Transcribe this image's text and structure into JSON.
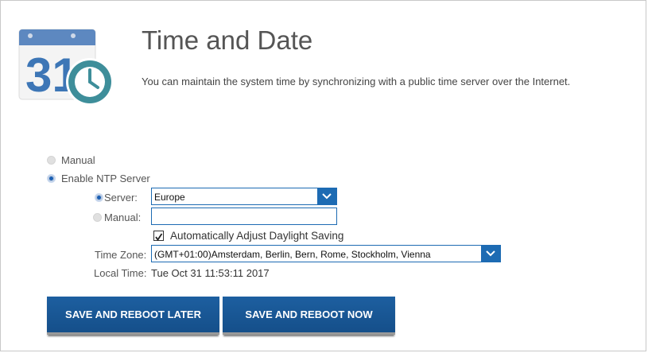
{
  "header": {
    "title": "Time and Date",
    "description": "You can maintain the system time by synchronizing with a public time server over the Internet.",
    "icon": "calendar-clock-icon",
    "icon_day": "31"
  },
  "mode": {
    "manual_label": "Manual",
    "ntp_label": "Enable NTP Server",
    "selected": "ntp"
  },
  "ntp": {
    "server_label": "Server:",
    "server_value": "Europe",
    "manual_label": "Manual:",
    "manual_value": "",
    "server_mode": "server",
    "dst_label": "Automatically Adjust Daylight Saving",
    "dst_checked": true
  },
  "timezone": {
    "label": "Time Zone:",
    "value": "(GMT+01:00)Amsterdam, Berlin, Bern, Rome, Stockholm, Vienna"
  },
  "local_time": {
    "label": "Local Time:",
    "value": "Tue Oct 31 11:53:11 2017"
  },
  "actions": {
    "save_later": "SAVE AND REBOOT LATER",
    "save_now": "SAVE AND REBOOT NOW"
  },
  "colors": {
    "accent": "#1d6bb3",
    "button": "#1a5a9a",
    "icon_teal": "#3e8e9a"
  }
}
